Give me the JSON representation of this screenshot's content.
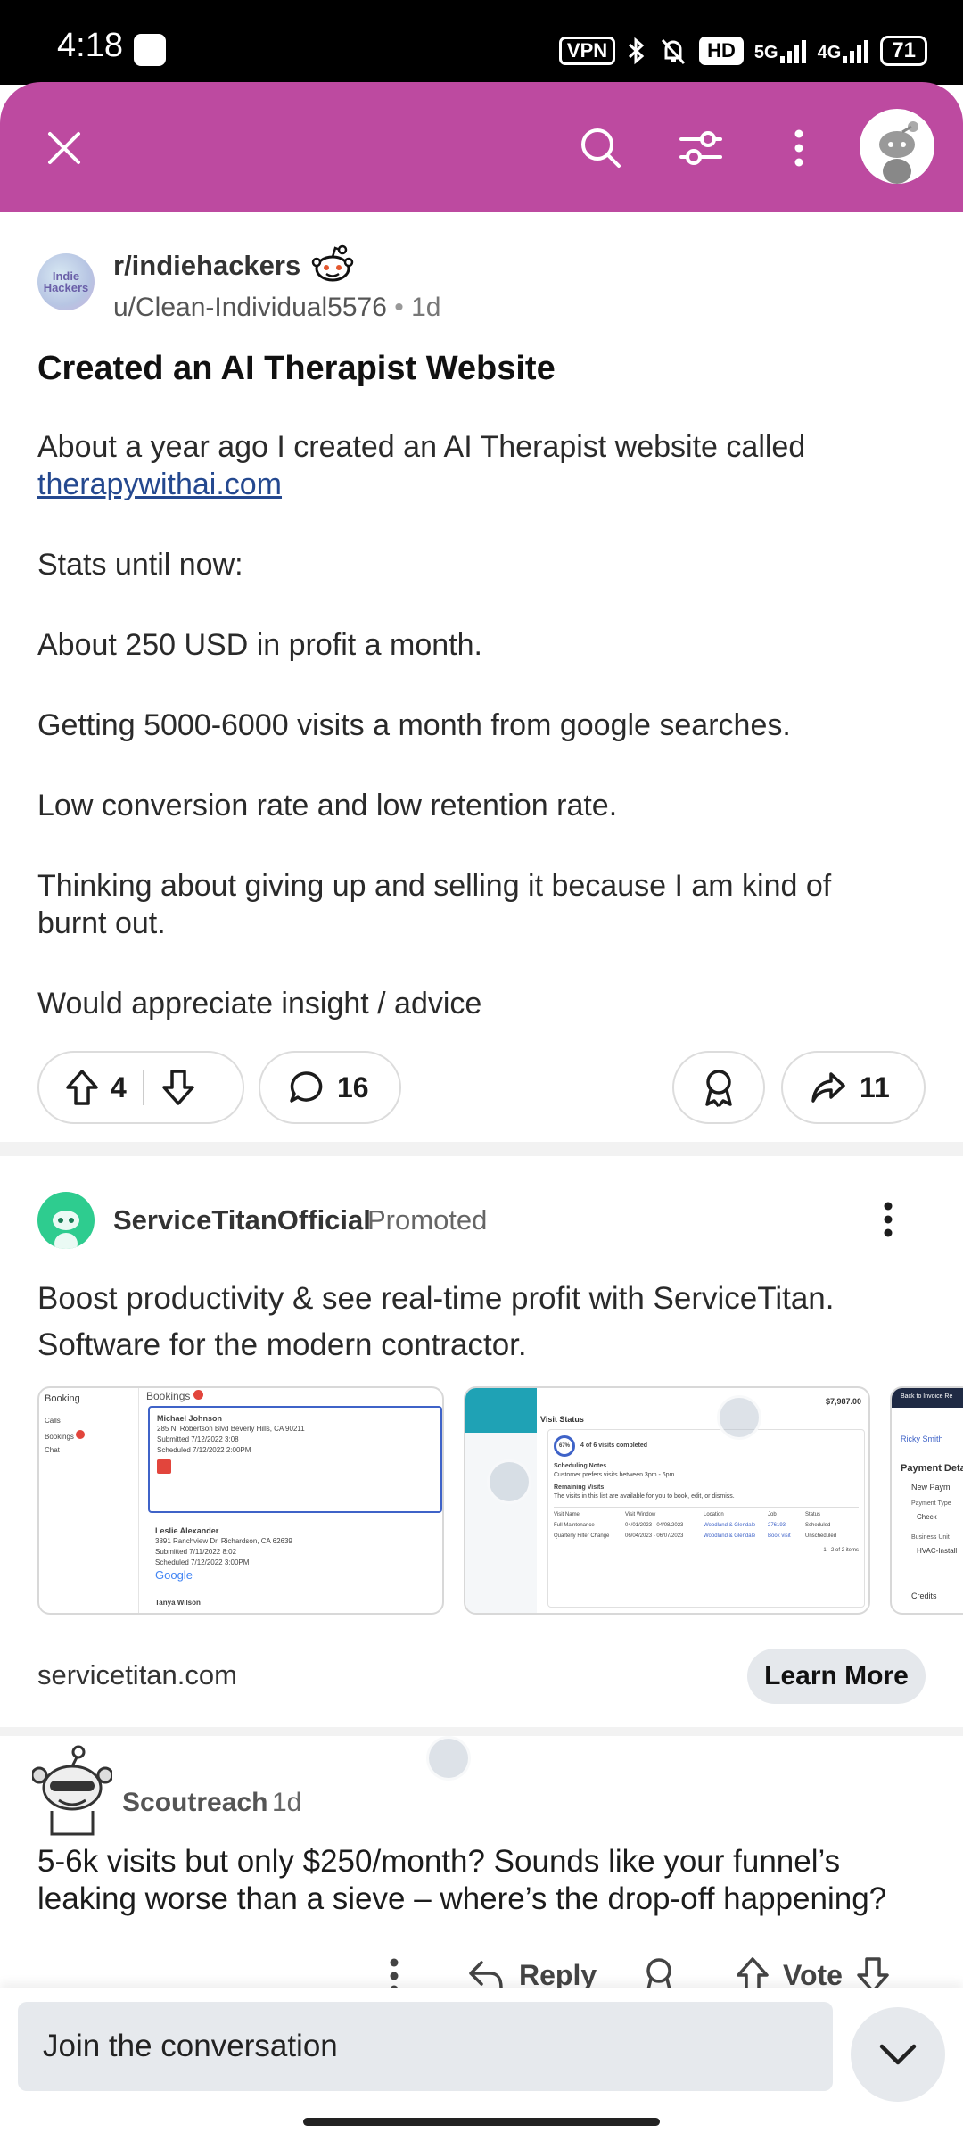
{
  "status_bar": {
    "time": "4:18",
    "vpn": "VPN",
    "hd": "HD",
    "network1": "5G",
    "network2": "4G",
    "battery": "71"
  },
  "app_bar": {
    "close_icon": "close-icon",
    "search_icon": "search-icon",
    "filter_icon": "sort-icon",
    "more_icon": "more-vertical-icon",
    "avatar": "snoo-avatar"
  },
  "post": {
    "subreddit": "r/indiehackers",
    "subreddit_avatar_text": "Indie Hackers",
    "author": "u/Clean-Individual5576",
    "separator": "•",
    "age": "1d",
    "title": "Created an AI Therapist Website",
    "body_line1": "About a year ago I created an AI Therapist website called",
    "link": "therapywithai.com",
    "paragraphs": [
      "Stats until now:",
      "About 250 USD in profit a month.",
      "Getting 5000-6000 visits a month from google searches.",
      "Low conversion rate and low retention rate.",
      "Thinking about giving up and selling it because I am kind of burnt out.",
      "Would appreciate insight / advice"
    ],
    "upvotes": "4",
    "comments": "16",
    "shares": "11"
  },
  "promoted": {
    "advertiser": "ServiceTitanOfficial",
    "tag": "Promoted",
    "text": "Boost productivity & see real-time profit with ServiceTitan. Software for the modern contractor.",
    "domain": "servicetitan.com",
    "cta": "Learn More",
    "card1": {
      "sidebar_title": "Booking",
      "sidebar_items": [
        "Calls",
        "Bookings",
        "Chat"
      ],
      "header": "Bookings",
      "person1": "Michael Johnson",
      "address1": "285 N. Robertson Blvd Beverly Hills, CA 90211",
      "submitted1": "Submitted 7/12/2022 3:08",
      "scheduled1": "Scheduled 7/12/2022 2:00PM",
      "person2": "Leslie Alexander",
      "address2": "3891 Ranchview Dr. Richardson, CA 62639",
      "submitted2": "Submitted 7/11/2022 8:02",
      "scheduled2": "Scheduled 7/12/2022 3:00PM",
      "google": "Google",
      "person3": "Tanya Wilson"
    },
    "card2": {
      "section": "Visit Status",
      "progress": "67%",
      "progress_text": "4 of 6 visits completed",
      "notes_title": "Scheduling Notes",
      "notes_text": "Customer prefers visits between 3pm - 6pm.",
      "remaining_title": "Remaining Visits",
      "remaining_text": "The visits in this list are available for you to book, edit, or dismiss.",
      "columns": [
        "Visit Name",
        "Visit Window",
        "Location",
        "Job",
        "Status"
      ],
      "rows": [
        [
          "Full Maintenance",
          "04/01/2023 - 04/08/2023",
          "Woodland & Glendale",
          "276193",
          "Scheduled"
        ],
        [
          "Quarterly Filter Change",
          "06/04/2023 - 06/07/2023",
          "Woodland & Glendale",
          "Book visit",
          "Unscheduled"
        ]
      ],
      "pager": "1 - 2 of 2 items",
      "total": "$7,987.00"
    },
    "card3": {
      "back": "Back to Invoice Re",
      "name": "Ricky Smith",
      "section": "Payment Deta",
      "option": "New Paym",
      "payment_type_label": "Payment Type",
      "payment_type": "Check",
      "business_unit_label": "Business Unit",
      "business_unit": "HVAC-Install",
      "credits": "Credits"
    }
  },
  "comment": {
    "user": "Scoutreach",
    "age": "1d",
    "text": "5-6k visits but only $250/month? Sounds like your funnel’s leaking worse than a sieve – where’s the drop-off happening?",
    "reply": "Reply",
    "vote": "Vote"
  },
  "composer": {
    "placeholder": "Join the conversation"
  },
  "colors": {
    "app_bar": "#bd4aa0",
    "link": "#24488f",
    "promo_avatar": "#2ecc8f"
  }
}
